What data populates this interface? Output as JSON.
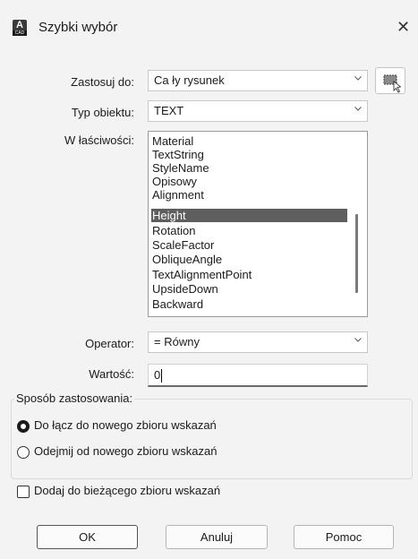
{
  "window": {
    "title": "Szybki wybór",
    "app_icon_letter": "A",
    "app_icon_text": "CAD",
    "close_glyph": "✕"
  },
  "apply_to": {
    "label": "Zastosuj do:",
    "value": "Ca ły rysunek"
  },
  "object_type": {
    "label": "Typ obiektu:",
    "value": "TEXT"
  },
  "properties": {
    "label": "W łaściwości:",
    "items": [
      "Material",
      "TextString",
      "StyleName",
      "Opisowy",
      "Alignment",
      "Height",
      "Rotation",
      "ScaleFactor",
      "ObliqueAngle",
      "TextAlignmentPoint",
      "UpsideDown",
      "Backward"
    ],
    "selected": "Height"
  },
  "operator": {
    "label": "Operator:",
    "value": "= Równy"
  },
  "value_field": {
    "label": "Wartość:",
    "value": "0"
  },
  "apply_mode": {
    "label": "Sposób zastosowania:",
    "options": [
      {
        "label": "Do łącz do nowego zbioru wskazań",
        "selected": true
      },
      {
        "label": "Odejmij od nowego zbioru wskazań",
        "selected": false
      }
    ]
  },
  "append_checkbox": {
    "label": "Dodaj do bieżącego zbioru wskazań",
    "checked": false
  },
  "buttons": {
    "ok": "OK",
    "cancel": "Anuluj",
    "help": "Pomoc"
  }
}
